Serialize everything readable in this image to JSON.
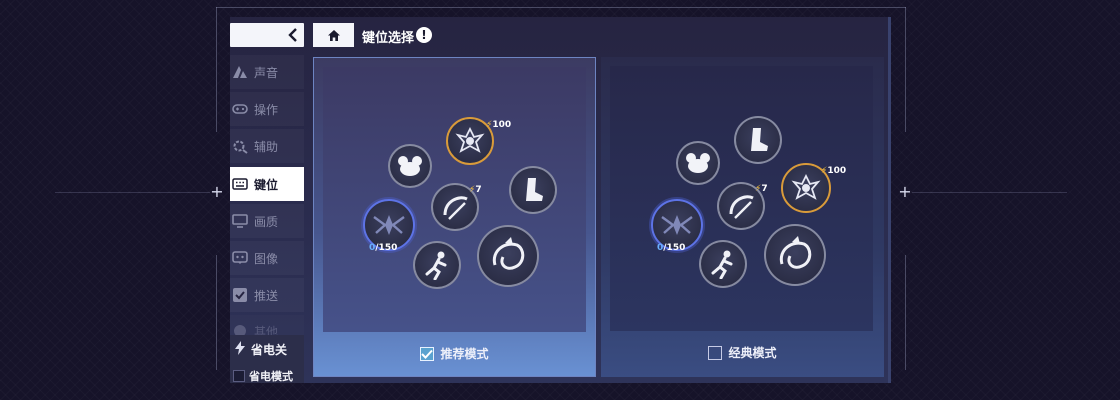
{
  "sidebar": {
    "back_icon": "chevron-left-icon",
    "items": [
      {
        "label": "声音",
        "icon": "sound-icon"
      },
      {
        "label": "操作",
        "icon": "gamepad-icon"
      },
      {
        "label": "辅助",
        "icon": "assist-gear-icon"
      },
      {
        "label": "键位",
        "icon": "keyboard-icon",
        "active": true
      },
      {
        "label": "画质",
        "icon": "display-icon"
      },
      {
        "label": "图像",
        "icon": "image-icon"
      },
      {
        "label": "推送",
        "icon": "check-square-icon"
      },
      {
        "label": "其他",
        "icon": "misc-icon"
      }
    ],
    "power_saving": {
      "label": "省电关",
      "icon": "lightning-icon",
      "mode_label": "省电模式",
      "mode_checked": false
    }
  },
  "header": {
    "home_icon": "home-icon",
    "title": "键位选择",
    "info_icon": "exclamation-icon"
  },
  "modes": {
    "recommended": {
      "label": "推荐模式",
      "checked": true,
      "skills": {
        "ultimate_cost": "100",
        "skill_cost": "7",
        "energy_current": "0",
        "energy_max": "/150"
      }
    },
    "classic": {
      "label": "经典模式",
      "checked": false,
      "skills": {
        "ultimate_cost": "100",
        "skill_cost": "7",
        "energy_current": "0",
        "energy_max": "/150"
      }
    }
  },
  "colors": {
    "accent_blue": "#5d73e6",
    "accent_gold": "#d99b3a",
    "bolt": "#ffc83a",
    "active_tab_bg": "#ffffff"
  }
}
